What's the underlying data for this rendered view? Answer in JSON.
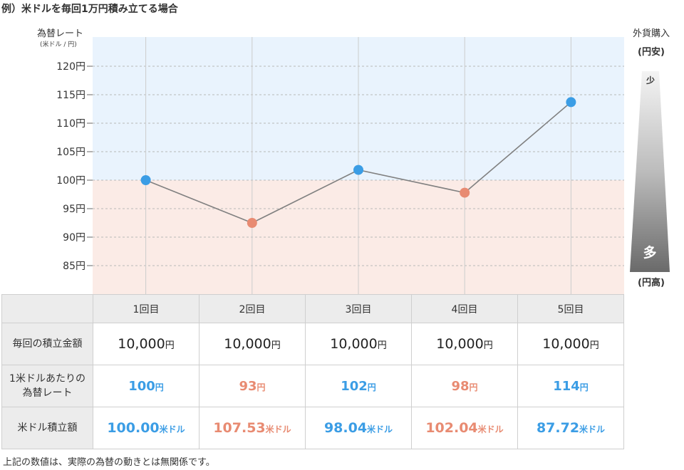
{
  "title": "例）米ドルを毎回1万円積み立てる場合",
  "y_axis": {
    "title": "為替レート",
    "unit": "(米ドル / 円)"
  },
  "right_panel": {
    "title": "外貨購入",
    "top_label": "(円安)",
    "top_amount": "少",
    "bottom_amount": "多",
    "bottom_label": "(円高)"
  },
  "colors": {
    "blue": "#3b9de5",
    "orange": "#e88b72",
    "bg_high": "#e9f3fd",
    "bg_low": "#fbebe6",
    "line": "#808080"
  },
  "chart_data": {
    "type": "line",
    "categories": [
      "1回目",
      "2回目",
      "3回目",
      "4回目",
      "5回目"
    ],
    "values": [
      100,
      92.5,
      101.8,
      97.8,
      113.7
    ],
    "ylim": [
      80,
      125
    ],
    "yticks": [
      85,
      90,
      95,
      100,
      105,
      110,
      115,
      120
    ],
    "tick_suffix": "円",
    "threshold": 100,
    "point_colors": [
      "blue",
      "orange",
      "blue",
      "orange",
      "blue"
    ]
  },
  "table": {
    "rows": [
      {
        "label": "毎回の積立金額",
        "cells": [
          {
            "num": "10,000",
            "unit": "円"
          },
          {
            "num": "10,000",
            "unit": "円"
          },
          {
            "num": "10,000",
            "unit": "円"
          },
          {
            "num": "10,000",
            "unit": "円"
          },
          {
            "num": "10,000",
            "unit": "円"
          }
        ]
      },
      {
        "label_line1": "1米ドルあたりの",
        "label_line2": "為替レート",
        "cells": [
          {
            "num": "100",
            "unit": "円",
            "color": "blue"
          },
          {
            "num": "93",
            "unit": "円",
            "color": "orange"
          },
          {
            "num": "102",
            "unit": "円",
            "color": "blue"
          },
          {
            "num": "98",
            "unit": "円",
            "color": "orange"
          },
          {
            "num": "114",
            "unit": "円",
            "color": "blue"
          }
        ]
      },
      {
        "label": "米ドル積立額",
        "cells": [
          {
            "num": "100.00",
            "unit": "米ドル",
            "color": "blue"
          },
          {
            "num": "107.53",
            "unit": "米ドル",
            "color": "orange"
          },
          {
            "num": "98.04",
            "unit": "米ドル",
            "color": "blue"
          },
          {
            "num": "102.04",
            "unit": "米ドル",
            "color": "orange"
          },
          {
            "num": "87.72",
            "unit": "米ドル",
            "color": "blue"
          }
        ]
      }
    ]
  },
  "footnote": "上記の数値は、実際の為替の動きとは無関係です。"
}
